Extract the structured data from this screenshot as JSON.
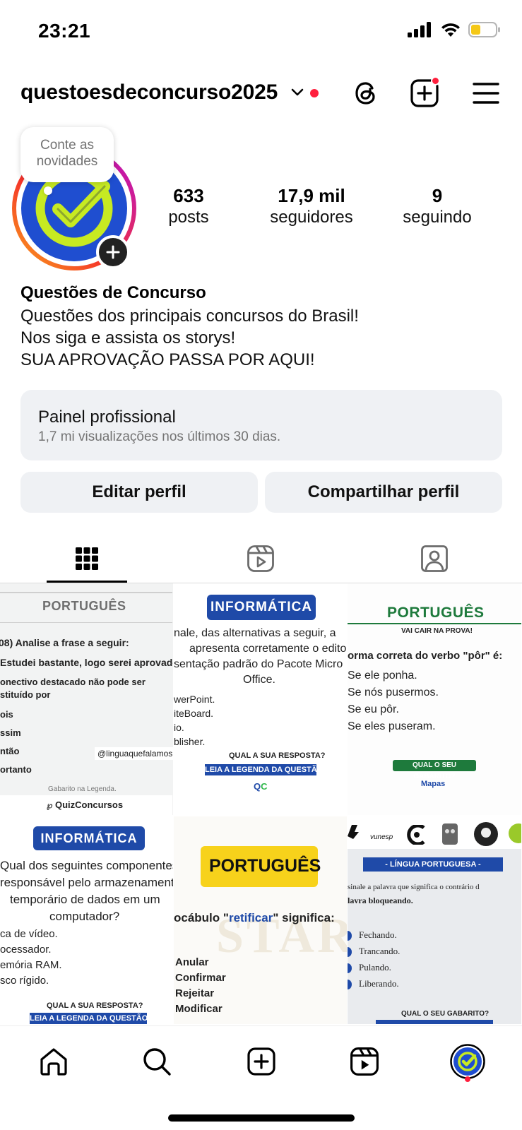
{
  "status_bar": {
    "time": "23:21"
  },
  "header": {
    "username": "questoesdeconcurso2025"
  },
  "note": {
    "text": "Conte as novidades"
  },
  "stats": [
    {
      "value": "633",
      "label": "posts"
    },
    {
      "value": "17,9 mil",
      "label": "seguidores"
    },
    {
      "value": "9",
      "label": "seguindo"
    }
  ],
  "bio": {
    "name": "Questões de Concurso",
    "lines": [
      "Questões dos principais concursos do Brasil!",
      "Nos siga e assista os storys!",
      "SUA APROVAÇÃO PASSA POR AQUI!"
    ]
  },
  "panel": {
    "title": "Painel profissional",
    "subtitle": "1,7 mi visualizações nos últimos 30 dias."
  },
  "buttons": {
    "edit": "Editar perfil",
    "share": "Compartilhar perfil"
  },
  "tabs": [
    "grid-icon",
    "reels-icon",
    "tagged-icon"
  ],
  "posts": {
    "p1": {
      "header": "PORTUGUÊS",
      "lines": [
        "08) Analise a frase a seguir:",
        "Estudei bastante, logo serei aprovado.\"",
        "onectivo destacado não pode ser",
        "stituído por",
        "ois",
        "ssim",
        "ntão",
        "ortanto"
      ],
      "handle": "@linguaquefalamos",
      "foot": "Gabarito na Legenda.",
      "brand": "QuizConcursos"
    },
    "p2": {
      "header": "INFORMÁTICA",
      "lines": [
        "nale, das alternativas a seguir, a",
        "apresenta corretamente o edito",
        "sentação padrão do Pacote Micro",
        "Office.",
        "werPoint.",
        "iteBoard.",
        "io.",
        "blisher."
      ],
      "q1": "QUAL A SUA RESPOSTA?",
      "q2": "LEIA A LEGENDA DA QUESTÃO!"
    },
    "p3": {
      "header": "PORTUGUÊS",
      "sub": "VAI CAIR NA PROVA!",
      "lines": [
        "orma correta do verbo \"pôr\" é:",
        "Se ele ponha.",
        "Se nós pusermos.",
        "Se eu pôr.",
        "Se eles puseram."
      ],
      "btn": "QUAL O SEU GABARITO?",
      "brand": "Mapas"
    },
    "p4": {
      "header": "INFORMÁTICA",
      "lines": [
        "Qual dos seguintes componentes",
        "responsável pelo armazenament",
        "temporário de dados em um",
        "computador?",
        "ca de vídeo.",
        "ocessador.",
        "emória RAM.",
        "sco rígido."
      ],
      "q1": "QUAL A SUA RESPOSTA?",
      "q2": "LEIA A LEGENDA DA QUESTÃO!"
    },
    "p5": {
      "header": "PORTUGUÊS",
      "question_pre": "ocábulo \"",
      "question_word": "retificar",
      "question_post": "\" significa:",
      "options": [
        "Anular",
        "Confirmar",
        "Rejeitar",
        "Modificar"
      ],
      "watermark": "START"
    },
    "p6": {
      "logo": "vunesp",
      "header": "- LÍNGUA PORTUGUESA -",
      "lines": [
        "sinale a palavra que significa o contrário d",
        "lavra bloqueando."
      ],
      "options": [
        "Fechando.",
        "Trancando.",
        "Pulando.",
        "Liberando."
      ],
      "btn": "QUAL O SEU GABARITO?"
    }
  },
  "bottom_nav": [
    "home-icon",
    "search-icon",
    "create-icon",
    "reels-icon",
    "profile-avatar"
  ],
  "colors": {
    "accent_red": "#ff1f3d",
    "panel_bg": "#eff1f4",
    "info_blue": "#1f4aa8",
    "pt_green": "#1e7a3c",
    "pt_yellow": "#f7d21b"
  }
}
